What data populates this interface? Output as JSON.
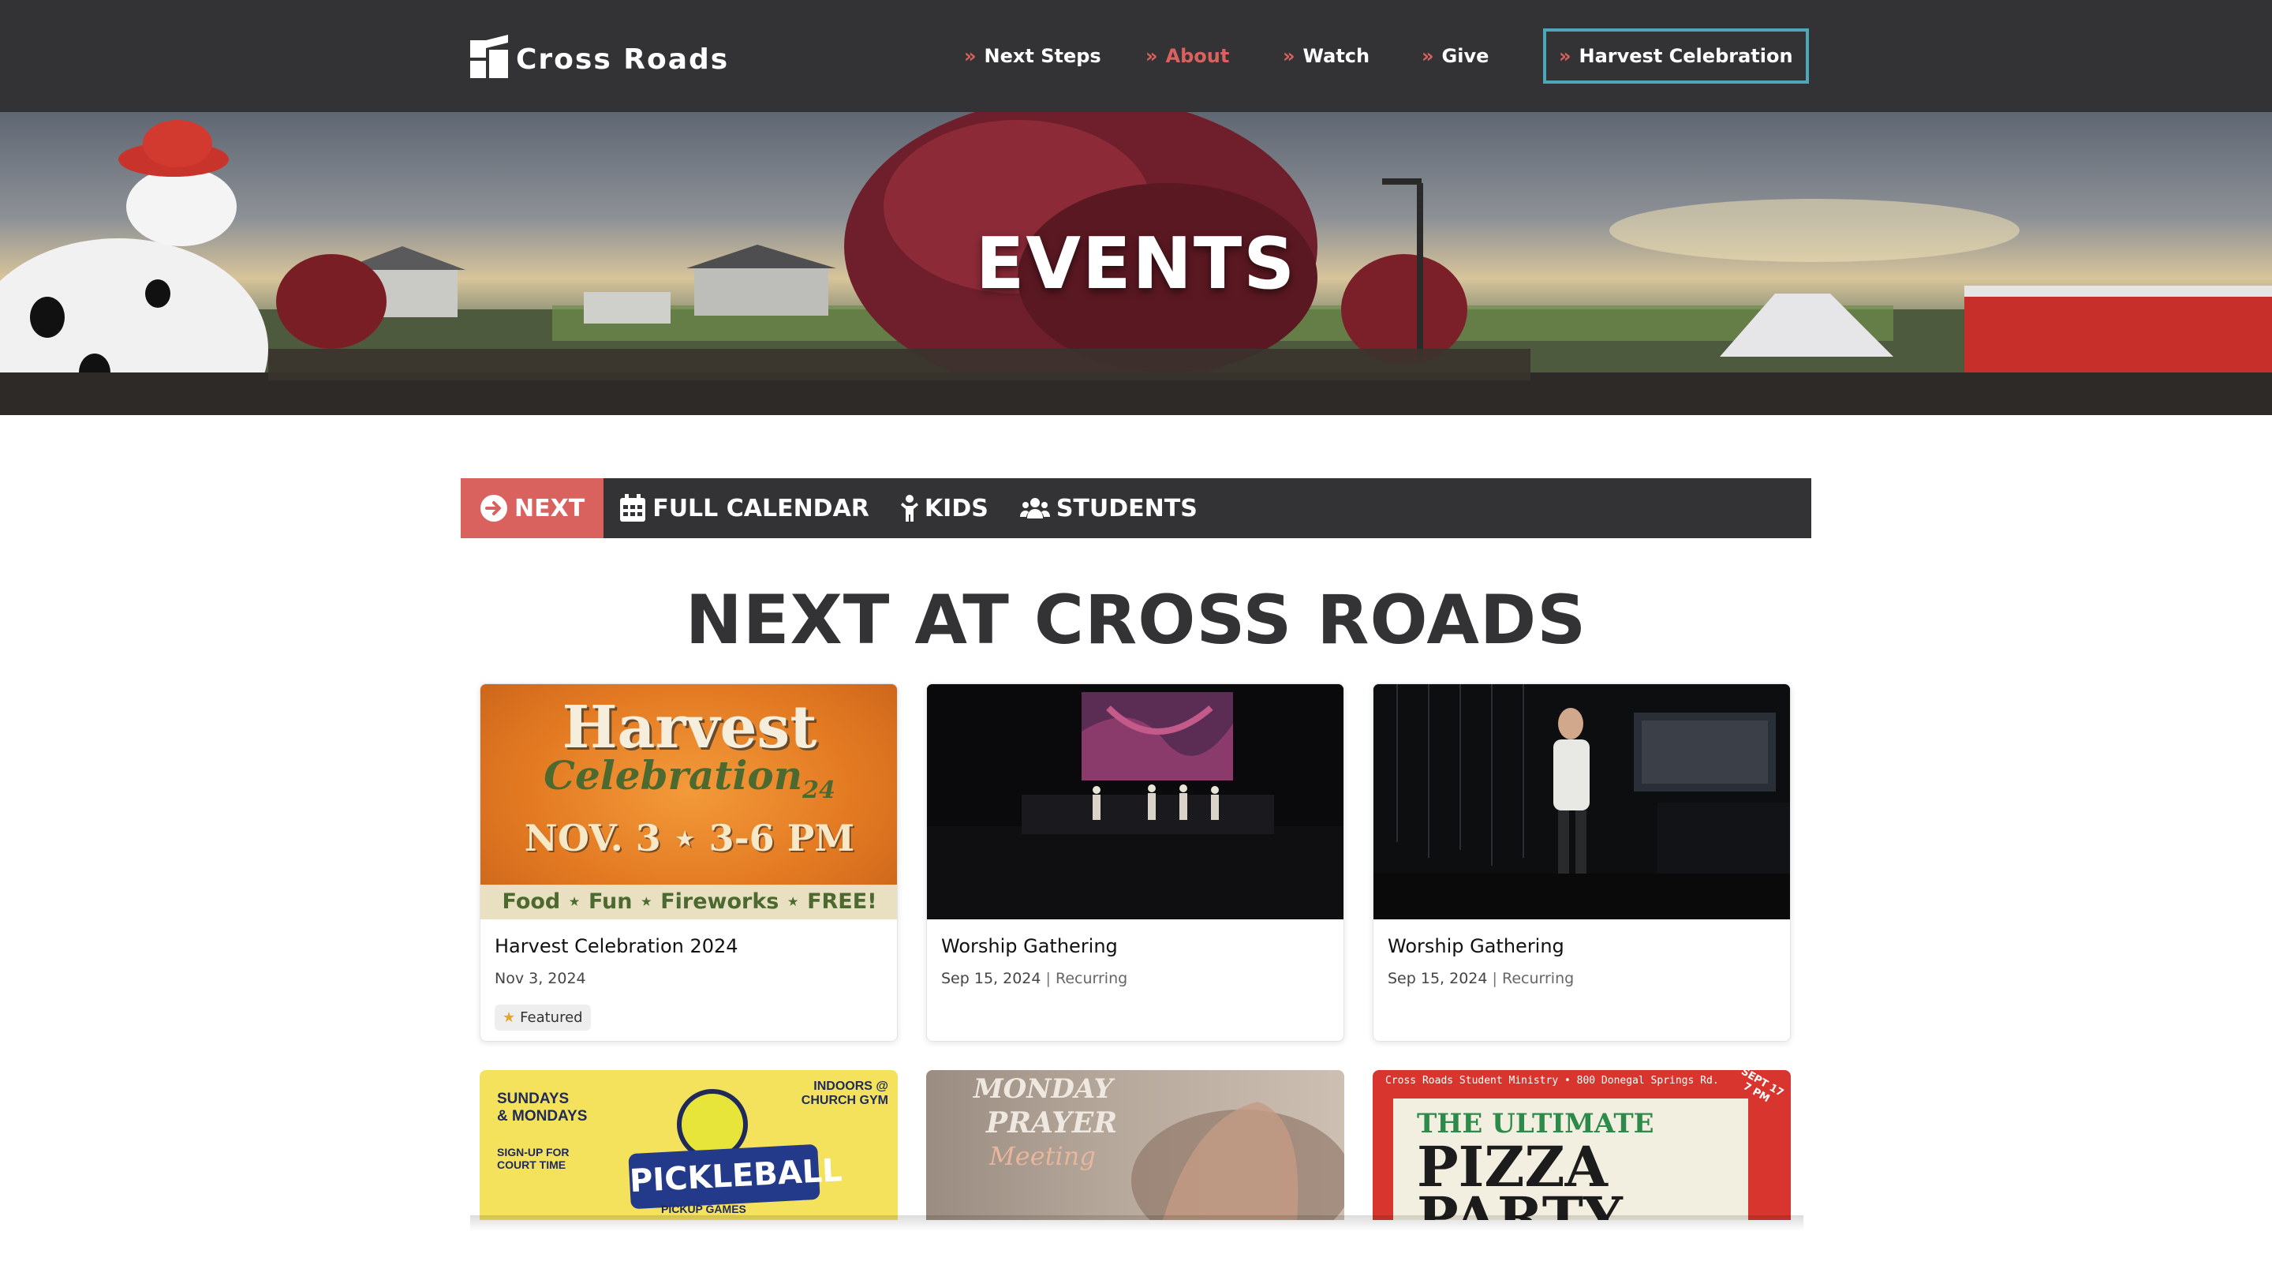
{
  "header": {
    "logo_text": "Cross Roads",
    "nav": [
      {
        "label": "Next Steps",
        "marker": "»"
      },
      {
        "label": "About",
        "marker": "»"
      },
      {
        "label": "Watch",
        "marker": "»"
      },
      {
        "label": "Give",
        "marker": "»"
      },
      {
        "label": "Harvest Celebration",
        "marker": "»"
      }
    ]
  },
  "hero": {
    "title": "EVENTS"
  },
  "tabs": [
    {
      "label": "NEXT",
      "icon": "arrow-right-circle-icon",
      "active": true
    },
    {
      "label": "FULL CALENDAR",
      "icon": "calendar-icon",
      "active": false
    },
    {
      "label": "KIDS",
      "icon": "child-icon",
      "active": false
    },
    {
      "label": "STUDENTS",
      "icon": "users-icon",
      "active": false
    }
  ],
  "section_title": "NEXT AT CROSS ROADS",
  "events": [
    {
      "title": "Harvest Celebration 2024",
      "date": "Nov 3, 2024",
      "badge": "Featured"
    },
    {
      "title": "Worship Gathering",
      "date": "Sep 15, 2024",
      "separator": "|",
      "recurring": "Recurring"
    },
    {
      "title": "Worship Gathering",
      "date": "Sep 15, 2024",
      "separator": "|",
      "recurring": "Recurring"
    }
  ],
  "harvest_art": {
    "word1": "Harvest",
    "word2": "Celebration",
    "year": "24",
    "date_line": "NOV. 3 ⋆ 3-6 PM",
    "strip": "Food ⋆ Fun ⋆ Fireworks ⋆ FREE!"
  },
  "pickleball_art": {
    "left_days": "SUNDAYS\n& MONDAYS",
    "left_signup": "SIGN-UP FOR\nCOURT TIME",
    "right": "INDOORS @\nCHURCH GYM",
    "title": "PICKLEBALL",
    "subtitle": "PICKUP GAMES"
  },
  "prayer_art": {
    "line1": "MONDAY",
    "line2": "PRAYER",
    "line3": "Meeting"
  },
  "pizza_art": {
    "top": "Cross Roads Student Ministry • 800 Donegal Springs Rd.",
    "line1": "THE ULTIMATE",
    "line2": "PIZZA",
    "line3": "PARTY",
    "date": "SEPT 17 7 PM"
  },
  "colors": {
    "dark": "#333335",
    "accent": "#d9625f",
    "cta_border": "#4ea7b8"
  }
}
